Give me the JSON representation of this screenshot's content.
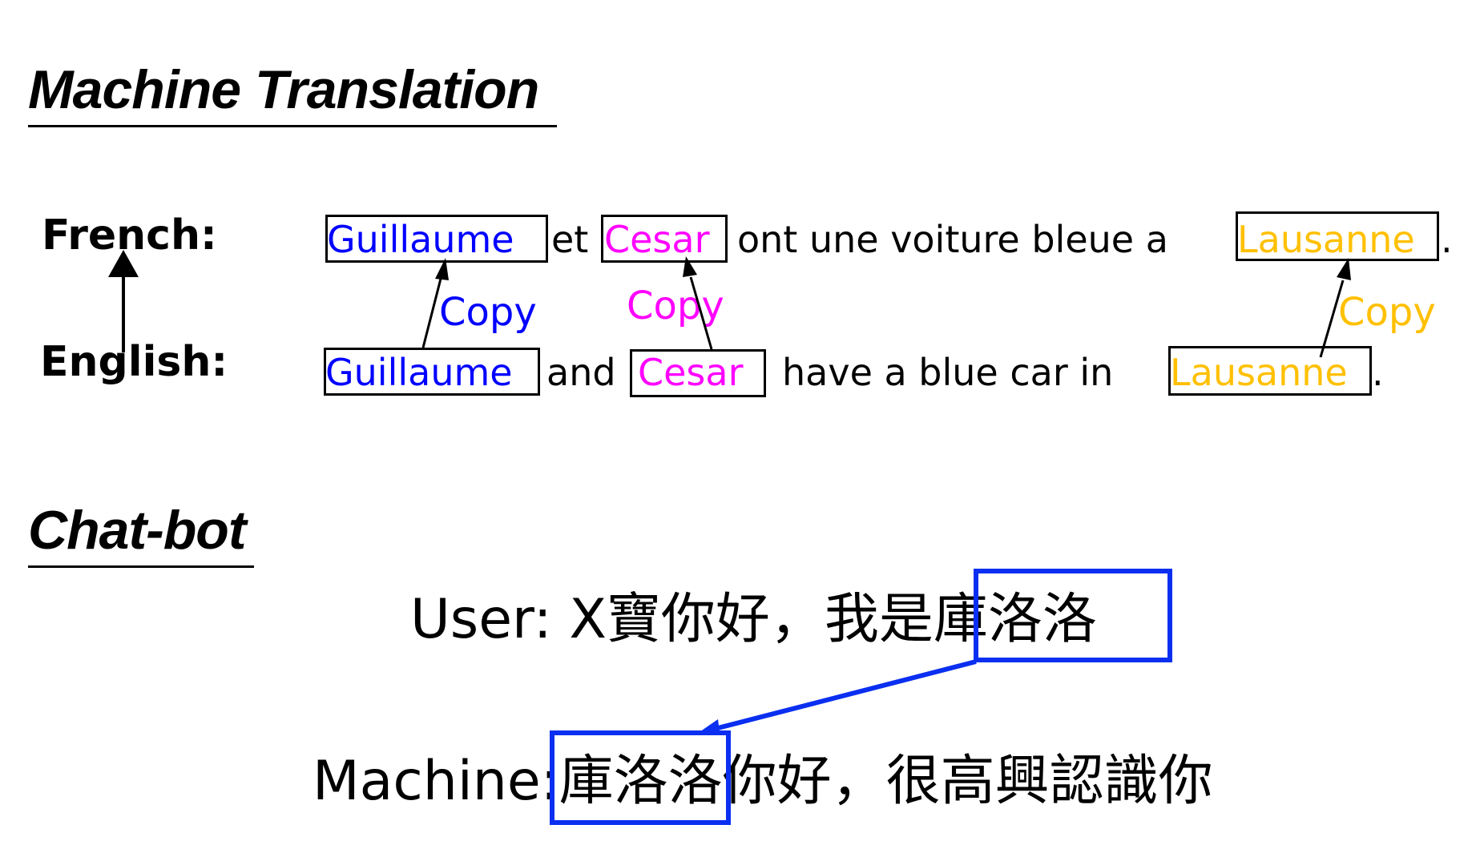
{
  "sections": {
    "machine_translation": {
      "title": "Machine Translation",
      "french_label": "French:",
      "english_label": "English:",
      "french_sentence": {
        "w1": "Guillaume",
        "t1": "et",
        "w2": "Cesar",
        "t2": "ont une voiture bleue a",
        "w3": "Lausanne",
        "t3": "."
      },
      "english_sentence": {
        "w1": "Guillaume",
        "t1": "and",
        "w2": "Cesar",
        "t2": "have a blue car in",
        "w3": "Lausanne",
        "t3": "."
      },
      "copy_labels": [
        "Copy",
        "Copy",
        "Copy"
      ],
      "colors": {
        "word1": "#0000ff",
        "word2": "#ff00ff",
        "word3": "#ffc000"
      }
    },
    "chatbot": {
      "title": "Chat-bot",
      "user_prefix": "User:  X寶你好，我是",
      "user_copied": "庫洛洛",
      "machine_prefix": "Machine:",
      "machine_copied": "庫洛洛",
      "machine_suffix": "你好，很高興認識你",
      "highlight_color": "#0a2ff0"
    }
  }
}
